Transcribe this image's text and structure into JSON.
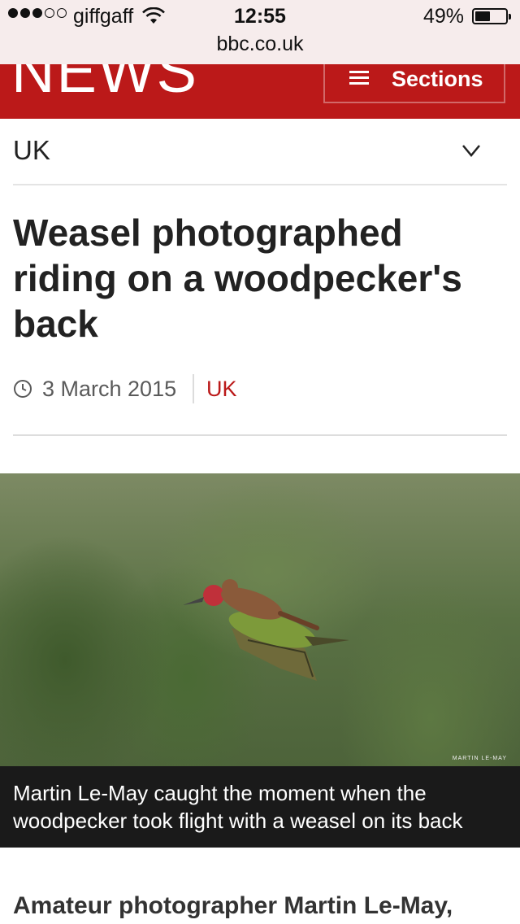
{
  "status_bar": {
    "carrier": "giffgaff",
    "time": "12:55",
    "battery_percent": "49%",
    "battery_level": 0.49,
    "signal_bars_filled": 3,
    "signal_bars_total": 5
  },
  "browser": {
    "url": "bbc.co.uk"
  },
  "header": {
    "logo_text": "NEWS",
    "sections_label": "Sections",
    "brand_color": "#bb1919"
  },
  "section_selector": {
    "label": "UK"
  },
  "article": {
    "headline": "Weasel photographed riding on a woodpecker's back",
    "date": "3 March 2015",
    "section": "UK",
    "image_credit": "MARTIN LE-MAY",
    "caption": "Martin Le-May caught the moment when the woodpecker took flight with a weasel on its back",
    "intro": "Amateur photographer Martin Le-May,"
  },
  "icons": {
    "menu": "hamburger-icon",
    "dropdown": "chevron-down-icon",
    "timestamp": "clock-icon",
    "wifi": "wifi-icon",
    "battery": "battery-icon"
  }
}
